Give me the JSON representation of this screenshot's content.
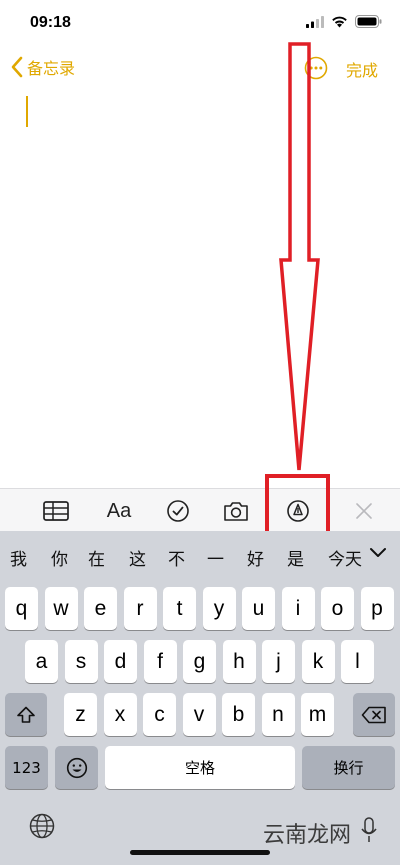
{
  "status": {
    "time": "09:18"
  },
  "nav": {
    "back_label": "备忘录",
    "done_label": "完成"
  },
  "toolbar": {
    "format_label": "Aa"
  },
  "candidates": [
    "我",
    "你",
    "在",
    "这",
    "不",
    "一",
    "好",
    "是",
    "今天"
  ],
  "keyboard": {
    "row1": [
      "q",
      "w",
      "e",
      "r",
      "t",
      "y",
      "u",
      "i",
      "o",
      "p"
    ],
    "row2": [
      "a",
      "s",
      "d",
      "f",
      "g",
      "h",
      "j",
      "k",
      "l"
    ],
    "row3": [
      "z",
      "x",
      "c",
      "v",
      "b",
      "n",
      "m"
    ],
    "numbers_label": "123",
    "space_label": "空格",
    "return_label": "换行"
  },
  "watermark": "云南龙网",
  "colors": {
    "accent": "#e0a800",
    "annotation": "#e01f26"
  }
}
